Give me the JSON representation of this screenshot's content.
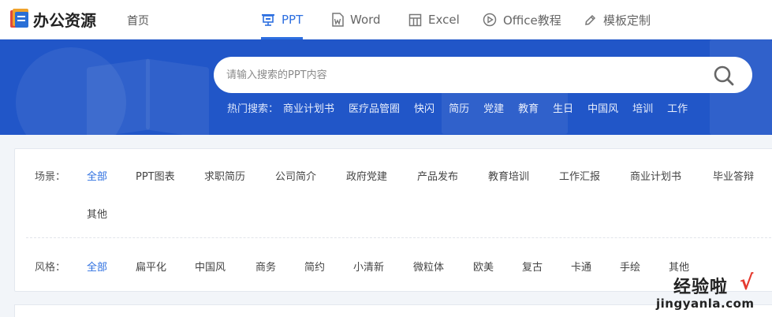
{
  "nav": {
    "logo_text": "办公资源",
    "home": "首页",
    "tabs": [
      {
        "label": "PPT",
        "icon": "presentation-icon",
        "active": true
      },
      {
        "label": "Word",
        "icon": "word-doc-icon",
        "active": false
      },
      {
        "label": "Excel",
        "icon": "table-icon",
        "active": false
      },
      {
        "label": "Office教程",
        "icon": "play-circle-icon",
        "active": false
      },
      {
        "label": "模板定制",
        "icon": "pen-icon",
        "active": false
      }
    ],
    "accent": "#2d6fe0"
  },
  "banner": {
    "background": "#2156c8",
    "search": {
      "placeholder": "请输入搜索的PPT内容",
      "value": ""
    },
    "hot_label": "热门搜索：",
    "hot_keywords": [
      "商业计划书",
      "医疗品管圈",
      "快闪",
      "简历",
      "党建",
      "教育",
      "生日",
      "中国风",
      "培训",
      "工作"
    ]
  },
  "filters": {
    "scene": {
      "label": "场景：",
      "options": [
        "全部",
        "PPT图表",
        "求职简历",
        "公司简介",
        "政府党建",
        "产品发布",
        "教育培训",
        "工作汇报",
        "商业计划书",
        "毕业答辩",
        "其他"
      ],
      "selected": "全部"
    },
    "style": {
      "label": "风格：",
      "options": [
        "全部",
        "扁平化",
        "中国风",
        "商务",
        "简约",
        "小清新",
        "微粒体",
        "欧美",
        "复古",
        "卡通",
        "手绘",
        "其他"
      ],
      "selected": "全部"
    }
  },
  "watermark": {
    "line1": "经验啦",
    "check": "√",
    "line2": "jingyanla.com"
  }
}
